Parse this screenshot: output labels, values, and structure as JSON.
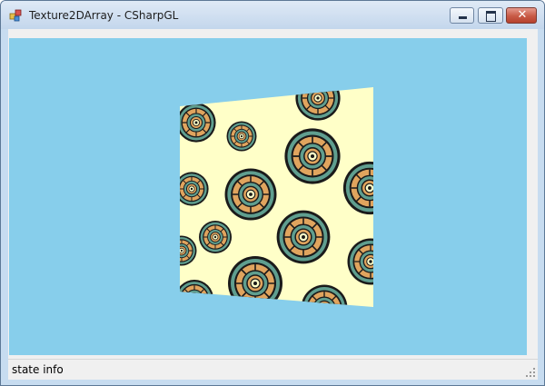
{
  "window": {
    "title": "Texture2DArray - CSharpGL",
    "icon": "csharpgl-app-icon",
    "buttons": {
      "minimize_icon": "minimize-icon",
      "maximize_icon": "maximize-icon",
      "close_icon": "close-icon",
      "close_glyph": "✕"
    }
  },
  "viewport": {
    "background_color": "#87ceeb",
    "texture_background": "#ffffc8",
    "pattern_colors": [
      "#1a1a1a",
      "#5f9e8f",
      "#e0a45e",
      "#ffffc8"
    ]
  },
  "status": {
    "label": "state info",
    "grip_icon": "size-grip-icon"
  }
}
